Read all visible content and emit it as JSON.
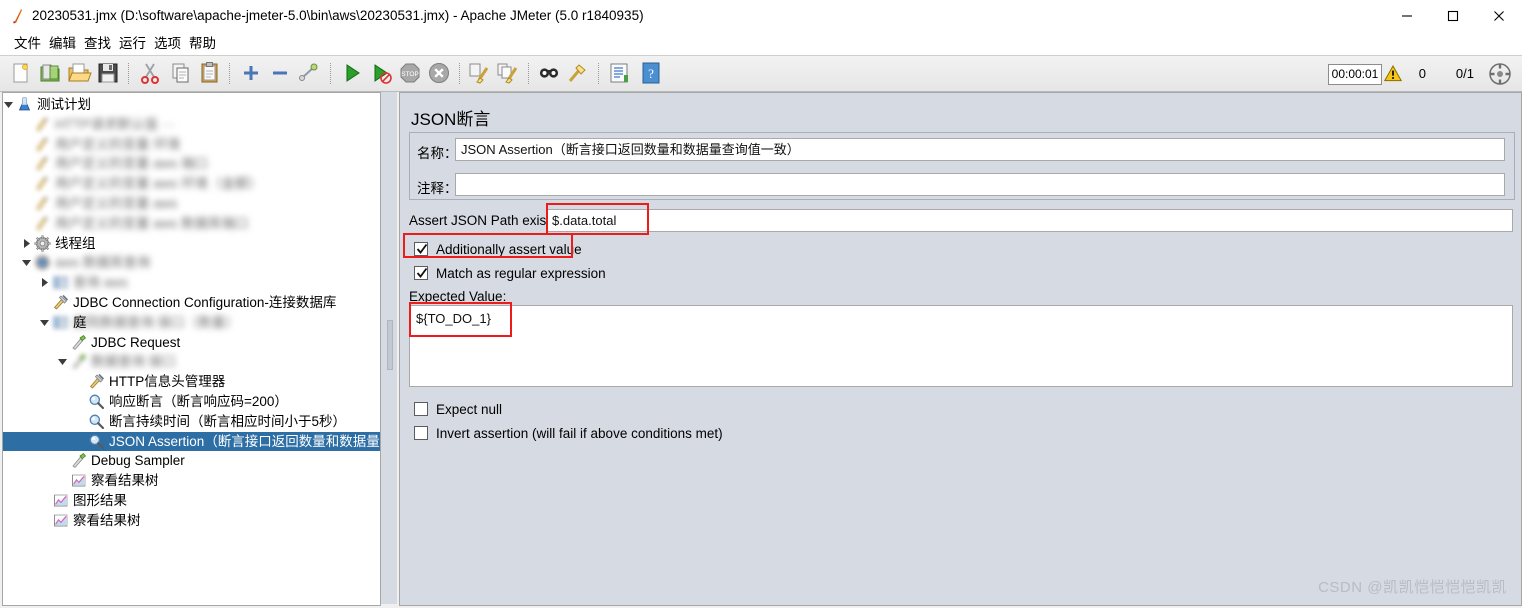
{
  "window": {
    "title": "20230531.jmx (D:\\software\\apache-jmeter-5.0\\bin\\aws\\20230531.jmx) - Apache JMeter (5.0 r1840935)",
    "app_icon": "jmeter-feather-icon",
    "minimize_label": "—",
    "maximize_label": "□",
    "close_label": "✕"
  },
  "menubar": {
    "items": [
      {
        "name": "menu-file",
        "label": "文件"
      },
      {
        "name": "menu-edit",
        "label": "编辑"
      },
      {
        "name": "menu-search",
        "label": "查找"
      },
      {
        "name": "menu-run",
        "label": "运行"
      },
      {
        "name": "menu-options",
        "label": "选项"
      },
      {
        "name": "menu-help",
        "label": "帮助"
      }
    ]
  },
  "toolbar": {
    "buttons": [
      "new-icon",
      "templates-icon",
      "open-icon",
      "save-icon",
      "cut-icon",
      "copy-icon",
      "paste-icon",
      "expand-icon",
      "collapse-icon",
      "toggle-icon",
      "start-icon",
      "start-no-timers-icon",
      "stop-icon",
      "shutdown-icon",
      "clear-icon",
      "clear-all-icon",
      "search-icon",
      "search-reset-icon",
      "function-helper-icon",
      "help-icon"
    ],
    "elapsed_time": "00:00:01",
    "warning_icon": "warning-triangle-icon",
    "warning_count": "0",
    "thread_count": "0/1",
    "resize_icon": "scroll-target-icon"
  },
  "tree": {
    "items": [
      {
        "id": "test-plan",
        "label": "测试计划",
        "indent": 0,
        "icon": "test-plan-icon",
        "toggle": "expanded",
        "blurred": false,
        "selected": false
      },
      {
        "id": "blurred-1",
        "label": "HTTP请求默认值 ···",
        "indent": 1,
        "icon": "config-icon",
        "toggle": "none",
        "blurred": true,
        "selected": false
      },
      {
        "id": "blurred-2",
        "label": "用户定义的变量 环境",
        "indent": 1,
        "icon": "config-icon",
        "toggle": "none",
        "blurred": true,
        "selected": false
      },
      {
        "id": "blurred-3",
        "label": "用户定义的变量 aws 端口",
        "indent": 1,
        "icon": "config-icon",
        "toggle": "none",
        "blurred": true,
        "selected": false
      },
      {
        "id": "blurred-4",
        "label": "用户定义的变量 aws 环境（金额）",
        "indent": 1,
        "icon": "config-icon",
        "toggle": "none",
        "blurred": true,
        "selected": false
      },
      {
        "id": "blurred-5",
        "label": "用户定义的变量 aws",
        "indent": 1,
        "icon": "config-icon",
        "toggle": "none",
        "blurred": true,
        "selected": false
      },
      {
        "id": "blurred-6",
        "label": "用户定义的变量 aws 数据库端口",
        "indent": 1,
        "icon": "config-icon",
        "toggle": "none",
        "blurred": true,
        "selected": false
      },
      {
        "id": "thread-group",
        "label": "线程组",
        "indent": 1,
        "icon": "thread-group-icon",
        "toggle": "collapsed",
        "blurred": false,
        "selected": false
      },
      {
        "id": "blurred-7",
        "label": "aws 数据库查询",
        "indent": 1,
        "icon": "thread-group-blue-icon",
        "toggle": "expanded",
        "blurred": true,
        "selected": false
      },
      {
        "id": "blurred-8",
        "label": "查询 aws",
        "indent": 2,
        "icon": "controller-icon",
        "toggle": "collapsed",
        "blurred": true,
        "selected": false
      },
      {
        "id": "jdbc-config",
        "label": "JDBC Connection Configuration-连接数据库",
        "indent": 2,
        "icon": "config-element-icon",
        "toggle": "none",
        "blurred": false,
        "selected": false
      },
      {
        "id": "blurred-9",
        "label": "庭院数据查询 接口（数量）",
        "indent": 2,
        "icon": "controller-icon",
        "toggle": "expanded",
        "blurred": true,
        "selected": false,
        "prefix": "庭"
      },
      {
        "id": "jdbc-request",
        "label": "JDBC Request",
        "indent": 3,
        "icon": "sampler-icon",
        "toggle": "none",
        "blurred": false,
        "selected": false
      },
      {
        "id": "blurred-10",
        "label": "数据查询 接口",
        "indent": 3,
        "icon": "sampler-icon",
        "toggle": "expanded",
        "blurred": true,
        "selected": false
      },
      {
        "id": "http-header",
        "label": "HTTP信息头管理器",
        "indent": 4,
        "icon": "config-element-icon",
        "toggle": "none",
        "blurred": false,
        "selected": false
      },
      {
        "id": "response-assert",
        "label": "响应断言（断言响应码=200）",
        "indent": 4,
        "icon": "assertion-icon",
        "toggle": "none",
        "blurred": false,
        "selected": false
      },
      {
        "id": "duration-assert",
        "label": "断言持续时间（断言相应时间小于5秒）",
        "indent": 4,
        "icon": "assertion-icon",
        "toggle": "none",
        "blurred": false,
        "selected": false
      },
      {
        "id": "json-assertion",
        "label": "JSON Assertion（断言接口返回数量和数据量查询值",
        "indent": 4,
        "icon": "assertion-icon",
        "toggle": "none",
        "blurred": false,
        "selected": true
      },
      {
        "id": "debug-sampler",
        "label": "Debug Sampler",
        "indent": 3,
        "icon": "sampler-icon",
        "toggle": "none",
        "blurred": false,
        "selected": false
      },
      {
        "id": "view-results-1",
        "label": "察看结果树",
        "indent": 3,
        "icon": "listener-icon",
        "toggle": "none",
        "blurred": false,
        "selected": false
      },
      {
        "id": "graph-results",
        "label": "图形结果",
        "indent": 2,
        "icon": "listener-icon",
        "toggle": "none",
        "blurred": false,
        "selected": false
      },
      {
        "id": "view-results-2",
        "label": "察看结果树",
        "indent": 2,
        "icon": "listener-icon",
        "toggle": "none",
        "blurred": false,
        "selected": false
      }
    ]
  },
  "panel": {
    "title": "JSON断言",
    "name_label": "名称：",
    "name_value": "JSON Assertion（断言接口返回数量和数据量查询值一致）",
    "comment_label": "注释：",
    "comment_value": "",
    "json_path_label": "Assert JSON Path exists:",
    "json_path_value": "$.data.total",
    "additionally_assert_label": "Additionally assert value",
    "additionally_assert_checked": true,
    "match_regex_label": "Match as regular expression",
    "match_regex_checked": true,
    "expected_value_label": "Expected Value:",
    "expected_value": "${TO_DO_1}",
    "expect_null_label": "Expect null",
    "expect_null_checked": false,
    "invert_assertion_label": "Invert assertion (will fail if above conditions met)",
    "invert_assertion_checked": false
  },
  "annotations": {
    "color": "#ee1b1b",
    "boxes": [
      "json-path-value-box",
      "additionally-assert-box",
      "expected-value-box"
    ]
  },
  "watermark": "CSDN @凯凯恺恺恺恺凯凯"
}
